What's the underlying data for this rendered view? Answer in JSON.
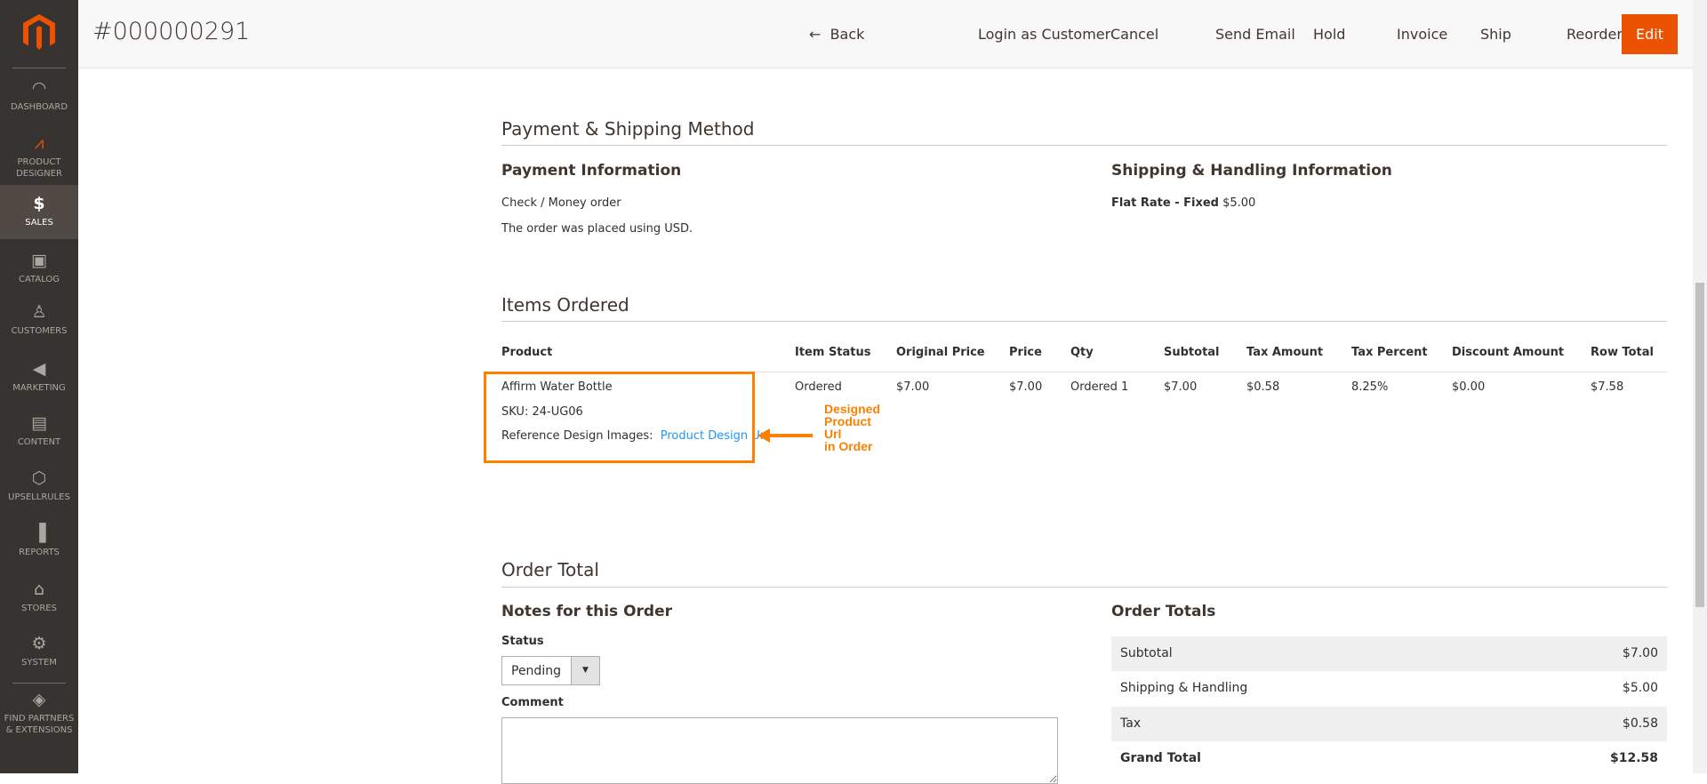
{
  "header": {
    "title": "#000000291",
    "buttons": {
      "back": "Back",
      "login": "Login as Customer",
      "cancel": "Cancel",
      "send_email": "Send Email",
      "hold": "Hold",
      "invoice": "Invoice",
      "ship": "Ship",
      "reorder": "Reorder",
      "edit": "Edit"
    }
  },
  "sidebar": {
    "items": [
      {
        "label": "Dashboard"
      },
      {
        "label": "Product Designer"
      },
      {
        "label": "Sales"
      },
      {
        "label": "Catalog"
      },
      {
        "label": "Customers"
      },
      {
        "label": "Marketing"
      },
      {
        "label": "Content"
      },
      {
        "label": "Upsellrules"
      },
      {
        "label": "Reports"
      },
      {
        "label": "Stores"
      },
      {
        "label": "System"
      },
      {
        "label": "Find Partners & Extensions"
      }
    ]
  },
  "payment_shipping": {
    "title": "Payment & Shipping Method",
    "payment_title": "Payment Information",
    "payment_method": "Check / Money order",
    "currency_note": "The order was placed using USD.",
    "shipping_title": "Shipping & Handling Information",
    "shipping_method": "Flat Rate - Fixed",
    "shipping_price": "$5.00"
  },
  "items": {
    "title": "Items Ordered",
    "columns": [
      "Product",
      "Item Status",
      "Original Price",
      "Price",
      "Qty",
      "Subtotal",
      "Tax Amount",
      "Tax Percent",
      "Discount Amount",
      "Row Total"
    ],
    "rows": [
      {
        "product": "Affirm Water Bottle",
        "sku": "SKU: 24-UG06",
        "ref_label": "Reference Design Images:",
        "ref_link": "Product Design Url",
        "status": "Ordered",
        "original_price": "$7.00",
        "price": "$7.00",
        "qty": "Ordered 1",
        "subtotal": "$7.00",
        "tax_amount": "$0.58",
        "tax_percent": "8.25%",
        "discount": "$0.00",
        "row_total": "$7.58"
      }
    ]
  },
  "annotation": {
    "text": [
      "Designed",
      "Product",
      "Url",
      "in Order"
    ],
    "color": "#ff8000"
  },
  "order_total": {
    "title": "Order Total",
    "notes_title": "Notes for this Order",
    "status_label": "Status",
    "status_value": "Pending",
    "comment_label": "Comment",
    "comment_value": "",
    "totals_title": "Order Totals",
    "totals": [
      {
        "label": "Subtotal",
        "value": "$7.00"
      },
      {
        "label": "Shipping & Handling",
        "value": "$5.00"
      },
      {
        "label": "Tax",
        "value": "$0.58"
      },
      {
        "label": "Grand Total",
        "value": "$12.58"
      }
    ]
  }
}
